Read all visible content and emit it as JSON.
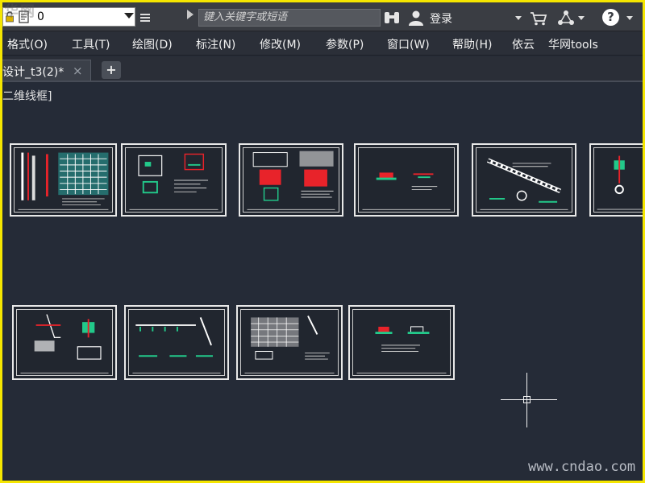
{
  "toolbar": {
    "watermark": "华网",
    "layer_value": "0",
    "search_placeholder": "键入关键字或短语",
    "login_label": "登录",
    "help_label": "?"
  },
  "menu": {
    "items": [
      "格式(O)",
      "工具(T)",
      "绘图(D)",
      "标注(N)",
      "修改(M)",
      "参数(P)",
      "窗口(W)",
      "帮助(H)",
      "依云",
      "华网tools"
    ]
  },
  "tabs": {
    "active_label": "设计_t3(2)*",
    "close_label": "×",
    "add_label": "+"
  },
  "viewport": {
    "label": "[-][俯视][二维线框]",
    "label_visible": "二维线框]"
  },
  "drawing_sheets": [
    {
      "id": "sheet-1"
    },
    {
      "id": "sheet-2"
    },
    {
      "id": "sheet-3"
    },
    {
      "id": "sheet-4"
    },
    {
      "id": "sheet-5"
    },
    {
      "id": "sheet-6"
    },
    {
      "id": "sheet-7"
    },
    {
      "id": "sheet-8"
    },
    {
      "id": "sheet-9"
    },
    {
      "id": "sheet-10"
    }
  ],
  "watermark": {
    "text": "www.cndao.com"
  },
  "colors": {
    "frame": "#f5e600",
    "canvas": "#252b37",
    "accent_red": "#e8232a",
    "accent_green": "#22c98a"
  },
  "icons": [
    "lock-icon",
    "layer-page-icon",
    "dropdown-icon",
    "binoculars-icon",
    "user-icon",
    "cart-icon",
    "exchange-icon",
    "help-icon",
    "crosshair-icon"
  ]
}
